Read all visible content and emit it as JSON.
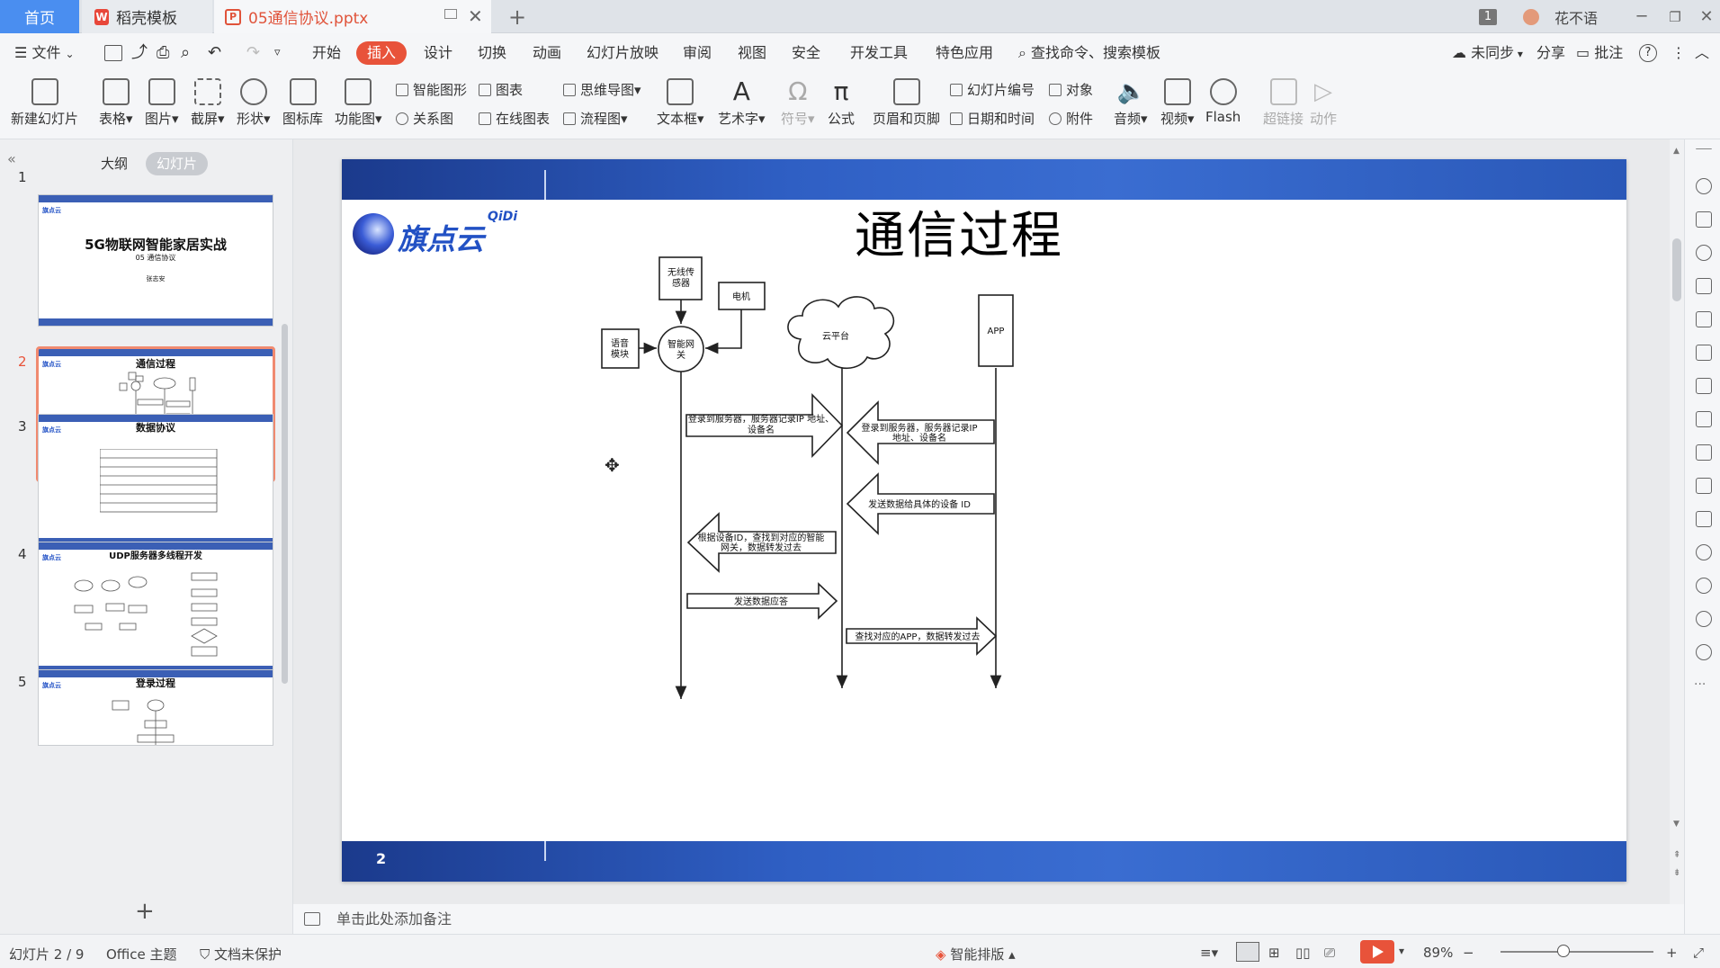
{
  "window": {
    "tabs": [
      {
        "label": "首页"
      },
      {
        "label": "稻壳模板"
      },
      {
        "label": "05通信协议.pptx"
      }
    ],
    "new_tab_symbol": "+",
    "page_badge": "1",
    "user_name": "花不语"
  },
  "menu": {
    "file_label": "文件",
    "items": [
      "开始",
      "插入",
      "设计",
      "切换",
      "动画",
      "幻灯片放映",
      "审阅",
      "视图",
      "安全",
      "开发工具",
      "特色应用"
    ],
    "search_placeholder": "查找命令、搜索模板",
    "sync_label": "未同步",
    "share_label": "分享",
    "comment_label": "批注"
  },
  "ribbon": {
    "new_slide": "新建幻灯片",
    "table": "表格",
    "picture": "图片",
    "screenshot": "截屏",
    "shape": "形状",
    "icon_lib": "图标库",
    "function_chart": "功能图",
    "smart_art": "智能图形",
    "chart": "图表",
    "relation": "关系图",
    "online_chart": "在线图表",
    "mindmap": "思维导图",
    "flowchart": "流程图",
    "textbox": "文本框",
    "wordart": "艺术字",
    "symbol": "符号",
    "formula": "公式",
    "header_footer": "页眉和页脚",
    "slide_number": "幻灯片编号",
    "object": "对象",
    "datetime": "日期和时间",
    "attachment": "附件",
    "audio": "音频",
    "video": "视频",
    "flash": "Flash",
    "hyperlink": "超链接",
    "action": "动作"
  },
  "panel": {
    "tab_outline": "大纲",
    "tab_slides": "幻灯片",
    "add_symbol": "+",
    "thumbs": [
      {
        "num": "1",
        "title": "5G物联网智能家居实战",
        "subtitle": "05 通信协议",
        "author": "张志安"
      },
      {
        "num": "2",
        "title": "通信过程"
      },
      {
        "num": "3",
        "title": "数据协议"
      },
      {
        "num": "4",
        "title": "UDP服务器多线程开发"
      },
      {
        "num": "5",
        "title": "登录过程"
      }
    ]
  },
  "slide": {
    "title": "通信过程",
    "number": "2",
    "logo_cn": "旗点云",
    "logo_en": "QiDi",
    "nodes": {
      "wireless": "无线传感器",
      "motor": "电机",
      "voice": "语音模块",
      "gateway": "智能网关",
      "cloud": "云平台",
      "app": "APP"
    },
    "messages": [
      "登录到服务器，服务器记录IP 地址、设备名",
      "登录到服务器，服务器记录IP 地址、设备名",
      "发送数据给具体的设备 ID",
      "根据设备ID，查找到对应的智能网关，数据转发过去",
      "发送数据应答",
      "查找对应的APP，数据转发过去"
    ]
  },
  "notes": {
    "placeholder": "单击此处添加备注"
  },
  "status": {
    "slide_info": "幻灯片 2 / 9",
    "theme": "Office 主题",
    "protect": "文档未保护",
    "smart_layout": "智能排版",
    "zoom": "89%"
  }
}
